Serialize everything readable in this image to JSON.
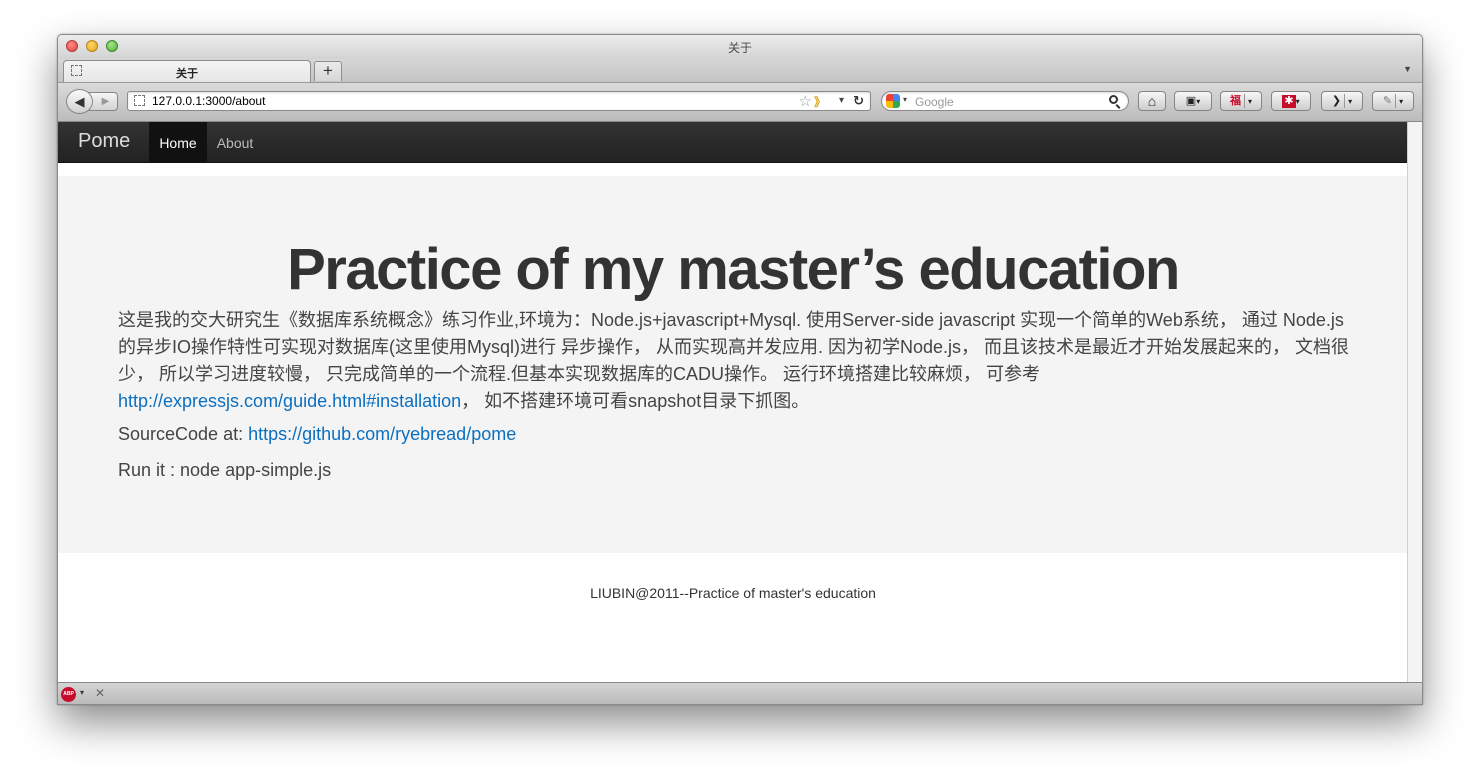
{
  "window": {
    "title": "关于"
  },
  "tab": {
    "label": "关于",
    "new_tab": "+",
    "list_arrow": "▼"
  },
  "toolbar": {
    "back": "◀",
    "forward": "▶",
    "url": "127.0.0.1:3000/about",
    "star": "☆",
    "feed": "》",
    "dropdown": "▾",
    "reload": "↻",
    "search_placeholder": "Google",
    "home": "⌂",
    "bookmarks": "▣",
    "ext1": "福",
    "ext2": "✱",
    "ext3": "❯",
    "ext4": "✎",
    "dd": "▾"
  },
  "navbar": {
    "brand": "Pome",
    "items": [
      "Home",
      "About"
    ]
  },
  "hero": {
    "title": "Practice of my master’s education",
    "desc_part1": "这是我的交大研究生《数据库系统概念》练习作业,环境为：Node.js+javascript+Mysql. 使用Server-side javascript 实现一个简单的Web系统， 通过 Node.js的异步IO操作特性可实现对数据库(这里使用Mysql)进行 异步操作， 从而实现高并发应用. 因为初学Node.js， 而且该技术是最近才开始发展起来的， 文档很少， 所以学习进度较慢， 只完成简单的一个流程.但基本实现数据库的CADU操作。 运行环境搭建比较麻烦， 可参考 ",
    "desc_link": "http://expressjs.com/guide.html#installation",
    "desc_part2": "， 如不搭建环境可看snapshot目录下抓图。",
    "source_label": "SourceCode at: ",
    "source_link": "https://github.com/ryebread/pome",
    "run_text": "Run it : node app-simple.js"
  },
  "footer": {
    "text": "LIUBIN@2011--Practice of master's education"
  },
  "statusbar": {
    "abp": "ABP",
    "dd": "▾",
    "close": "✕"
  },
  "colors": {
    "navbar_bg": "#222222",
    "hero_bg": "#f4f4f4",
    "link": "#0b6fc0",
    "title": "#333333"
  }
}
